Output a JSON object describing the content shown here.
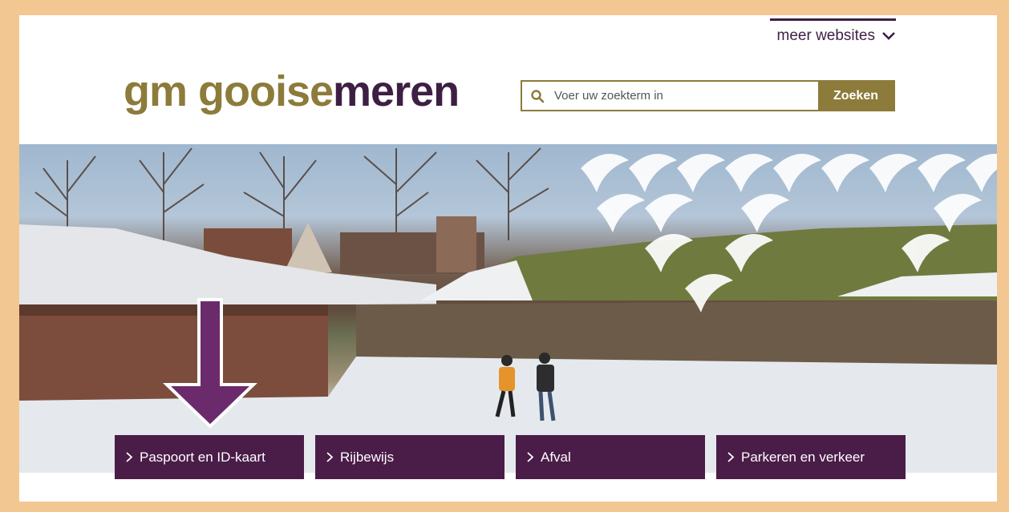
{
  "header": {
    "meer_websites": "meer websites",
    "logo": {
      "gm": "gm",
      "word1": "gooise",
      "word2": "meren"
    }
  },
  "search": {
    "placeholder": "Voer uw zoekterm in",
    "button_label": "Zoeken"
  },
  "tiles": [
    {
      "label": "Paspoort en ID-kaart"
    },
    {
      "label": "Rijbewijs"
    },
    {
      "label": "Afval"
    },
    {
      "label": "Parkeren en verkeer"
    }
  ],
  "icons": {
    "search": "search-icon",
    "chevron_down": "chevron-down-icon",
    "chevron_right": "chevron-right-icon",
    "annotation_arrow": "arrow-down-icon"
  },
  "colors": {
    "frame": "#f3c791",
    "brand_gold": "#8c7b3a",
    "brand_purple": "#3e1f44",
    "tile_purple": "#4a1c48",
    "annotation_arrow": "#6b2a6b"
  }
}
